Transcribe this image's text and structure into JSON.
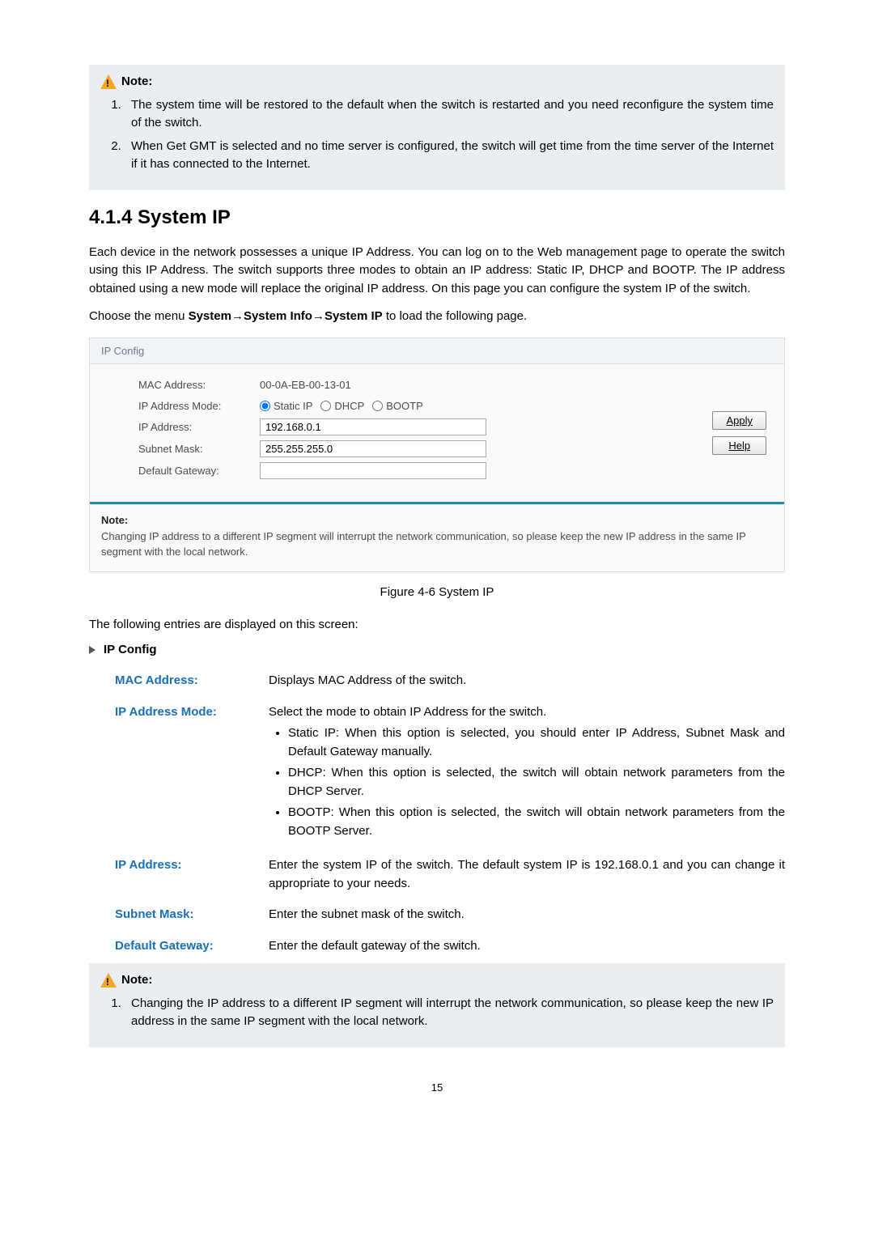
{
  "topNote": {
    "heading": "Note:",
    "items": [
      "The system time will be restored to the default when the switch is restarted and you need reconfigure the system time of the switch.",
      "When Get GMT is selected and no time server is configured, the switch will get time from the time server of the Internet if it has connected to the Internet."
    ]
  },
  "section": {
    "number_title": "4.1.4 System IP",
    "intro": "Each device in the network possesses a unique IP Address. You can log on to the Web management page to operate the switch using this IP Address. The switch supports three modes to obtain an IP address: Static IP, DHCP and BOOTP. The IP address obtained using a new mode will replace the original IP address. On this page you can configure the system IP of the switch.",
    "menu_prefix": "Choose the menu ",
    "menu_bold": "System→System Info→System IP",
    "menu_suffix": " to load the following page."
  },
  "panel": {
    "title": "IP Config",
    "labels": {
      "mac": "MAC Address:",
      "mode": "IP Address Mode:",
      "ip": "IP Address:",
      "subnet": "Subnet Mask:",
      "gateway": "Default Gateway:"
    },
    "values": {
      "mac": "00-0A-EB-00-13-01",
      "ip": "192.168.0.1",
      "subnet": "255.255.255.0",
      "gateway": ""
    },
    "modes": {
      "static": "Static IP",
      "dhcp": "DHCP",
      "bootp": "BOOTP"
    },
    "buttons": {
      "apply": "Apply",
      "help": "Help"
    },
    "note_label": "Note:",
    "note_text": "Changing IP address to a different IP segment will interrupt the network communication, so please keep the new IP address in the same IP segment with the local network."
  },
  "figure_caption": "Figure 4-6 System IP",
  "entries_intro": "The following entries are displayed on this screen:",
  "entries_heading": "IP Config",
  "defs": {
    "mac": {
      "label": "MAC Address:",
      "text": "Displays MAC Address of the switch."
    },
    "mode": {
      "label": "IP Address Mode:",
      "text": "Select the mode to obtain IP Address for the switch.",
      "bullets": [
        "Static IP: When this option is selected, you should enter IP Address, Subnet Mask and Default Gateway manually.",
        "DHCP: When this option is selected, the switch will obtain network parameters from the DHCP Server.",
        "BOOTP: When this option is selected, the switch will obtain network parameters from the BOOTP Server."
      ]
    },
    "ip": {
      "label": "IP Address:",
      "text": "Enter the system IP of the switch. The default system IP is 192.168.0.1 and you can change it appropriate to your needs."
    },
    "subnet": {
      "label": "Subnet Mask:",
      "text": "Enter the subnet mask of the switch."
    },
    "gateway": {
      "label": "Default Gateway:",
      "text": "Enter the default gateway of the switch."
    }
  },
  "bottomNote": {
    "heading": "Note:",
    "items": [
      "Changing the IP address to a different IP segment will interrupt the network communication, so please keep the new IP address in the same IP segment with the local network."
    ]
  },
  "page_number": "15"
}
